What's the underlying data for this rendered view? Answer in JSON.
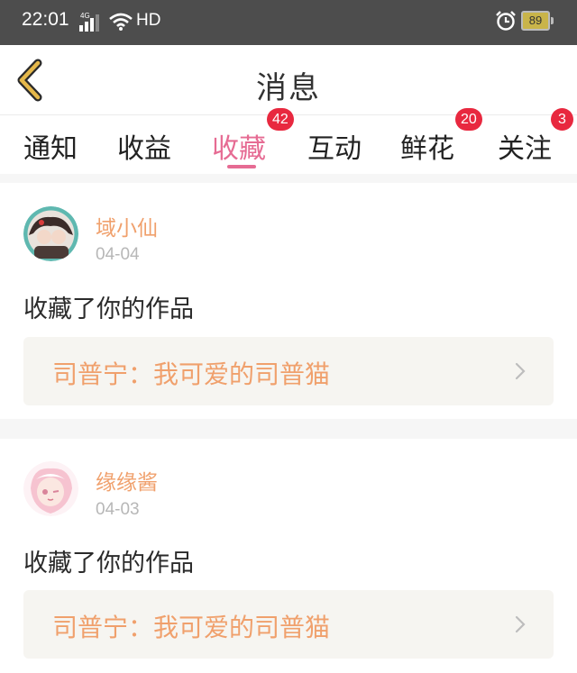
{
  "status_bar": {
    "time": "22:01",
    "network": "4G",
    "hd": "HD",
    "battery": "89"
  },
  "header": {
    "title": "消息",
    "back_icon": "chevron-left-icon"
  },
  "tabs": [
    {
      "label": "通知",
      "badge": ""
    },
    {
      "label": "收益",
      "badge": ""
    },
    {
      "label": "收藏",
      "badge": "42",
      "active": true
    },
    {
      "label": "互动",
      "badge": ""
    },
    {
      "label": "鲜花",
      "badge": "20"
    },
    {
      "label": "关注",
      "badge": "3"
    }
  ],
  "messages": [
    {
      "sender": "域小仙",
      "date": "04-04",
      "action": "收藏了你的作品",
      "work_title": "司普宁：我可爱的司普猫"
    },
    {
      "sender": "缘缘酱",
      "date": "04-03",
      "action": "收藏了你的作品",
      "work_title": "司普宁：我可爱的司普猫"
    }
  ],
  "colors": {
    "accent": "#e66b93",
    "sender": "#f0a06c",
    "badge": "#e8283f",
    "back_arrow": "#e5b84a"
  }
}
